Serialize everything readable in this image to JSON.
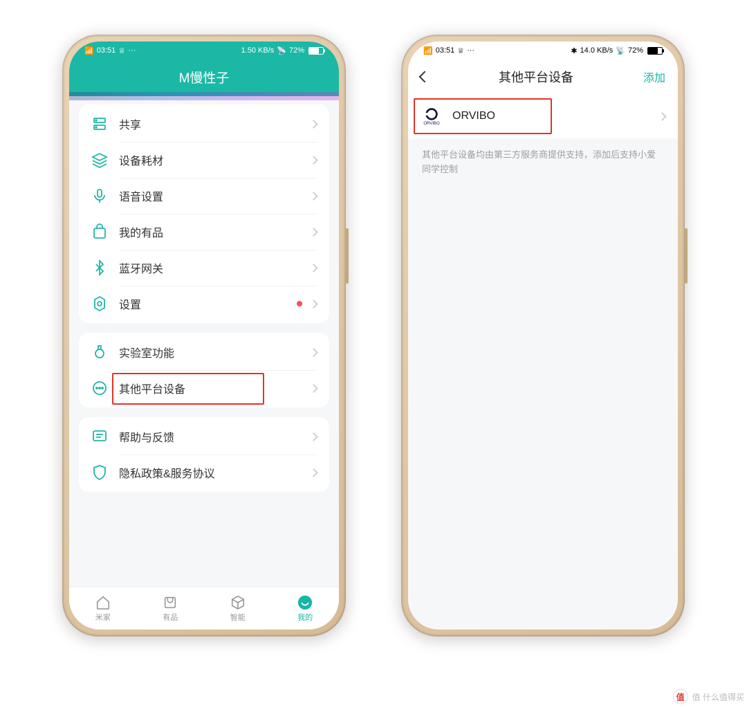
{
  "status": {
    "signal": "4G HD",
    "time": "03:51",
    "crown": "♕",
    "more": "···",
    "speed_left": "1.50 KB/s",
    "speed_right": "14.0 KB/s",
    "wifi": "72%"
  },
  "left": {
    "header_title": "M慢性子",
    "groups": [
      {
        "items": [
          {
            "icon": "share-icon",
            "label": "共享"
          },
          {
            "icon": "stack-icon",
            "label": "设备耗材"
          },
          {
            "icon": "mic-icon",
            "label": "语音设置"
          },
          {
            "icon": "bag-icon",
            "label": "我的有品"
          },
          {
            "icon": "bluetooth-icon",
            "label": "蓝牙网关"
          },
          {
            "icon": "gear-icon",
            "label": "设置",
            "red_dot": true
          }
        ]
      },
      {
        "items": [
          {
            "icon": "flask-icon",
            "label": "实验室功能"
          },
          {
            "icon": "dots-circle-icon",
            "label": "其他平台设备",
            "highlight": true
          }
        ]
      },
      {
        "items": [
          {
            "icon": "feedback-icon",
            "label": "帮助与反馈"
          },
          {
            "icon": "shield-icon",
            "label": "隐私政策&服务协议"
          }
        ]
      }
    ],
    "nav": [
      {
        "label": "米家",
        "icon": "home-icon"
      },
      {
        "label": "有品",
        "icon": "store-icon"
      },
      {
        "label": "智能",
        "icon": "cube-icon"
      },
      {
        "label": "我的",
        "icon": "smile-icon",
        "active": true
      }
    ]
  },
  "right": {
    "header_title": "其他平台设备",
    "add_label": "添加",
    "platform_item": {
      "label": "ORVIBO",
      "sub": "ORVIBO"
    },
    "hint": "其他平台设备均由第三方服务商提供支持，添加后支持小爱同学控制"
  },
  "watermark": "值 什么值得买"
}
